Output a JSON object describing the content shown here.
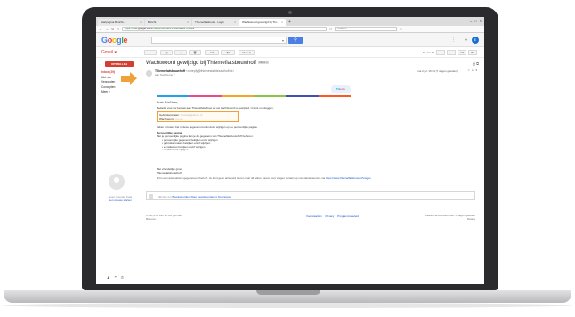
{
  "browser": {
    "tabs": [
      {
        "label": "Startpagina Bericht...",
        "active": false
      },
      {
        "label": "Bericht",
        "active": false
      },
      {
        "label": "Thiemeflatsbouw · Login",
        "active": false
      },
      {
        "label": "Wachtwoord gewijzigd bij Thi...",
        "active": true
      }
    ],
    "url_prefix": "https://mail.",
    "url_host": "google.com",
    "url_rest": "/mail/u/0/#inbox/15d1e0aa9f7c1d1a",
    "search_placeholder": "Zoeken"
  },
  "gmail": {
    "logo_letters": [
      "G",
      "o",
      "o",
      "g",
      "l",
      "e"
    ],
    "label": "Gmail ▾",
    "compose": "OPSTELLEN",
    "nav": [
      {
        "label": "Inbox (29)",
        "selected": true
      },
      {
        "label": "Met ster",
        "selected": false
      },
      {
        "label": "Verzonden",
        "selected": false
      },
      {
        "label": "Concepten",
        "selected": false
      },
      {
        "label": "Meer ▾",
        "selected": false
      }
    ],
    "hangout_text": "Geen recente chats",
    "hangout_link": "Een nieuwe starten",
    "page_count": "15 van 15",
    "toolbar_more": "Meer ▾"
  },
  "email": {
    "subject": "Wachtwoord gewijzigd bij Thiemeflatsbouwhoff",
    "inbox_tag": "Inbox ×",
    "sender_name": "Thiemeflatsbouwhoff",
    "sender_addr": "<noreply@thiemeslabdezaalhoff.nl>",
    "to_line": "aan Test/Demo ▾",
    "date": "ma 2 jul. 15:23 (7 dagen geleden)",
    "brand": [
      "Thi",
      "em",
      "e"
    ],
    "greeting": "Beste Eric/Nova,",
    "p1": "Bedankt voor uw bezoek aan Thiemeflatsbouw en uw wachtwoord is gewijzigd. U kunt nu inloggen.",
    "cred_user_label": "Gebruikersnaam:",
    "cred_user_value": "testuser@demo.nl",
    "cred_pass_label": "Wachtwoord:",
    "cred_pass_value": "••••••••",
    "p2": "Indien u fouten ziet in deze gegevens kunt u deze wijzigen op de persoonlijke pagina.",
    "personal_heading": "Persoonlijke pagina",
    "p3": "Met je persoonlijke pagina kan je de gegevens van Thiemeflatsbouwhoff beheren.",
    "bullets": [
      "persoonlijke gegevens bekijken en/of wijzigen",
      "gebruikersnaam bekijken en/of wijzigen",
      "e-mailadres bekijken en/of wijzigen",
      "wachtwoord wijzigen"
    ],
    "sig_1": "Met vriendelijke groet,",
    "sig_2": "Thiemeflatsbouwhoff",
    "footer_note": "Dit is een automatisch gegenereerd bericht. Je kunt geen antwoord sturen naar dit adres. Neem voor vragen contact op met klantenservice via",
    "footer_link": "https://www.thiemeflatsbouw.nl/vragen"
  },
  "reply": {
    "prompt": "Klik hier om",
    "reply_link": "Beantwoorden",
    "or": ", ",
    "reply_all_link": "Allen beantwoorden",
    "or2": " of ",
    "forward_link": "Doorsturen"
  },
  "footer": {
    "storage_1": "0 GB (0%) van 15 GB gebruikt",
    "storage_2": "Beheren",
    "links": [
      "Voorwaarden",
      "Privacy",
      "Programmabeleid"
    ],
    "activity_1": "Laatste accountactiviteit: 0 dagen geleden",
    "activity_2": "Details"
  },
  "colors": {
    "accent_red": "#d23f31",
    "highlight_orange": "#f0a23a",
    "link_blue": "#1155cc",
    "stripe": [
      "#1ea5e9",
      "#e94b8a",
      "#f5a623",
      "#8bc34a",
      "#3f51b5",
      "#ff5722"
    ]
  }
}
